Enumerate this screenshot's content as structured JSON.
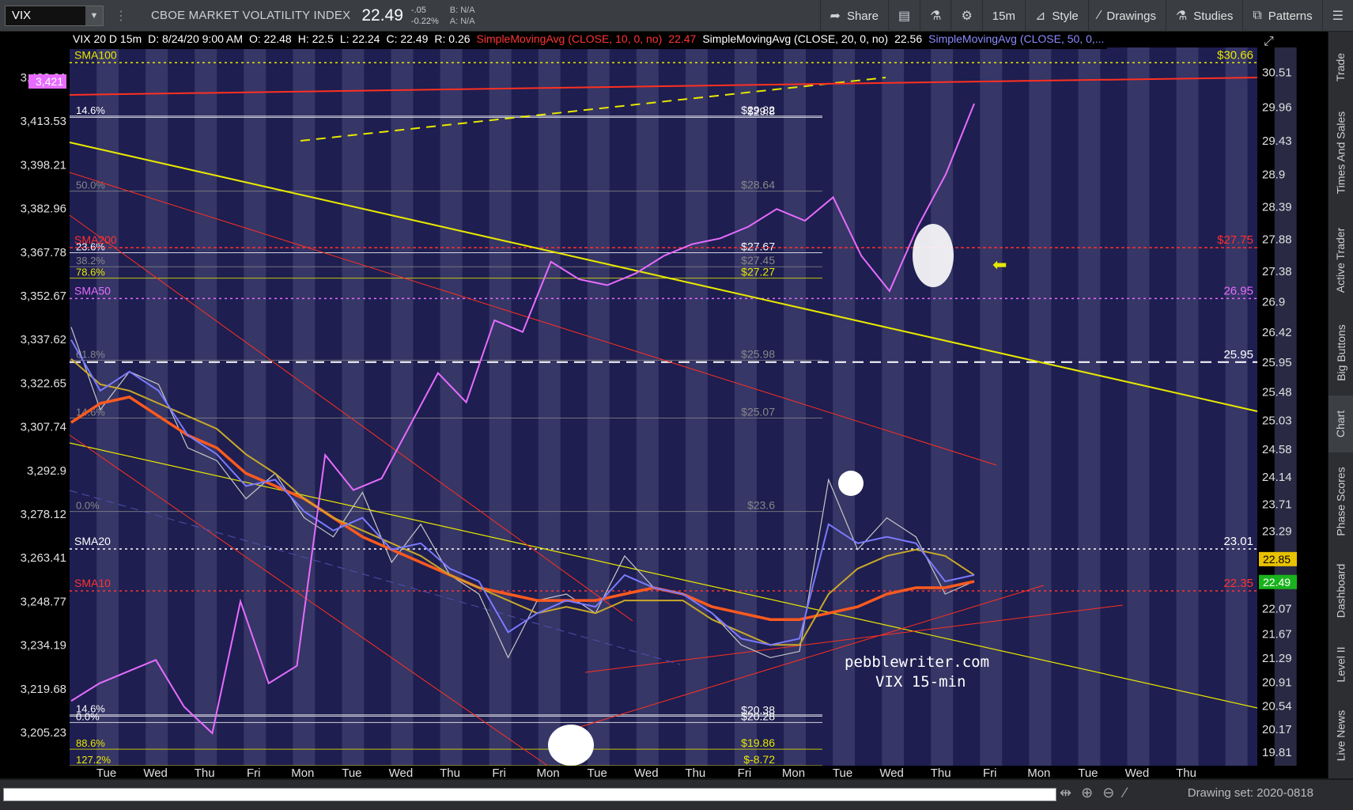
{
  "toolbar": {
    "symbol": "VIX",
    "name": "CBOE MARKET VOLATILITY INDEX",
    "price": "22.49",
    "change": "-.05",
    "change_pct": "-0.22%",
    "bid": "B: N/A",
    "ask": "A: N/A",
    "share": "Share",
    "timeframe": "15m",
    "style": "Style",
    "drawings": "Drawings",
    "studies": "Studies",
    "patterns": "Patterns"
  },
  "info": {
    "symbol": "VIX 20 D 15m",
    "date": "D: 8/24/20 9:00 AM",
    "open": "O: 22.48",
    "high": "H: 22.5",
    "low": "L: 22.24",
    "close": "C: 22.49",
    "range": "R: 0.26",
    "sma10": "SimpleMovingAvg (CLOSE, 10, 0, no)",
    "sma10_val": "22.47",
    "sma20": "SimpleMovingAvg (CLOSE, 20, 0, no)",
    "sma20_val": "22.56",
    "sma50": "SimpleMovingAvg (CLOSE, 50, 0,..."
  },
  "right_tabs": [
    "Trade",
    "Times And Sales",
    "Active Trader",
    "Big Buttons",
    "Chart",
    "Phase Scores",
    "Dashboard",
    "Level II",
    "Live News"
  ],
  "active_tab": "Chart",
  "bottom": {
    "drawing_set": "Drawing set: 2020-0818"
  },
  "watermark": {
    "line1": "pebblewriter.com",
    "line2": "VIX 15-min"
  },
  "chart_data": {
    "type": "line",
    "x_labels": [
      "Tue",
      "Wed",
      "Thu",
      "Fri",
      "Mon",
      "Tue",
      "Wed",
      "Thu",
      "Fri",
      "Mon",
      "Tue",
      "Wed",
      "Thu",
      "Fri",
      "Mon",
      "Tue",
      "Wed",
      "Thu",
      "Fri",
      "Mon",
      "Tue",
      "Wed",
      "Thu"
    ],
    "left_axis": [
      "3,428.91",
      "3,413.53",
      "3,398.21",
      "3,382.96",
      "3,367.78",
      "3,352.67",
      "3,337.62",
      "3,322.65",
      "3,307.74",
      "3,292.9",
      "3,278.12",
      "3,263.41",
      "3,248.77",
      "3,234.19",
      "3,219.68",
      "3,205.23"
    ],
    "right_axis": [
      "30.51",
      "29.96",
      "29.43",
      "28.9",
      "28.39",
      "27.88",
      "27.38",
      "26.9",
      "26.42",
      "25.95",
      "25.48",
      "25.03",
      "24.58",
      "24.14",
      "23.71",
      "23.29",
      "22.07",
      "21.67",
      "21.29",
      "20.91",
      "20.54",
      "20.17",
      "19.81"
    ],
    "ylim_right": [
      19.6,
      30.9
    ],
    "left_price_tag": "3,421",
    "tags": [
      {
        "text": "22.85",
        "value": 22.85,
        "bg": "#e8c200",
        "fg": "#000000"
      },
      {
        "text": "22.49",
        "value": 22.49,
        "bg": "#19b31c",
        "fg": "#ffffff"
      }
    ],
    "hlines": [
      {
        "label": "SMA20",
        "value_label": "23.01",
        "value": 23.01,
        "color": "#ffffff",
        "dash": "3,4"
      },
      {
        "label": "SMA10",
        "value_label": "22.35",
        "value": 22.35,
        "color": "#ff3333",
        "dash": "3,4"
      },
      {
        "label": "SMA50",
        "value_label": "26.95",
        "value": 26.95,
        "color": "#e66cff",
        "dash": "3,4"
      },
      {
        "label": "SMA200",
        "value_label": "$27.75",
        "value": 27.75,
        "color": "#ff3030",
        "dash": "4,3"
      },
      {
        "label": "SMA100",
        "value_label": "$30.66",
        "value": 30.66,
        "color": "#e8e800",
        "dash": "3,4"
      },
      {
        "label": "",
        "value_label": "25.95",
        "value": 25.95,
        "color": "#ffffff",
        "dash": "14,8"
      }
    ],
    "fib_levels": [
      {
        "label": "14.6%",
        "value_label": "$29.82",
        "value": 29.82,
        "color": "#ffffff"
      },
      {
        "label": "",
        "value_label": "$29.8",
        "value": 29.8,
        "color": "#ffffff"
      },
      {
        "label": "50.0%",
        "value_label": "$28.64",
        "value": 28.64,
        "color": "#888888"
      },
      {
        "label": "23.6%",
        "value_label": "$27.67",
        "value": 27.67,
        "color": "#ffffff"
      },
      {
        "label": "38.2%",
        "value_label": "$27.45",
        "value": 27.45,
        "color": "#888888"
      },
      {
        "label": "78.6%",
        "value_label": "$27.27",
        "value": 27.27,
        "color": "#e8e800"
      },
      {
        "label": "61.8%",
        "value_label": "$25.98",
        "value": 25.98,
        "color": "#888888"
      },
      {
        "label": "14.6%",
        "value_label": "$25.07",
        "value": 25.07,
        "color": "#888888"
      },
      {
        "label": "0.0%",
        "value_label": "$23.6",
        "value": 23.6,
        "color": "#888888"
      },
      {
        "label": "14.6%",
        "value_label": "",
        "value": 20.4,
        "color": "#ffffff"
      },
      {
        "label": "0.0%",
        "value_label": "$20.28",
        "value": 20.28,
        "color": "#ffffff"
      },
      {
        "label": "",
        "value_label": "$20.38",
        "value": 20.38,
        "color": "#ffffff"
      },
      {
        "label": "88.6%",
        "value_label": "$19.86",
        "value": 19.86,
        "color": "#e8e800"
      },
      {
        "label": "127.2%",
        "value_label": "$-8.72",
        "value": 19.6,
        "color": "#e8e800"
      }
    ],
    "series": [
      {
        "name": "VIX",
        "color": "#c8c8c8",
        "values": [
          26.5,
          25.2,
          25.8,
          25.6,
          24.6,
          24.4,
          23.8,
          24.2,
          23.5,
          23.2,
          23.9,
          22.8,
          23.4,
          22.6,
          22.3,
          21.3,
          22.2,
          22.3,
          22.0,
          22.9,
          22.4,
          22.3,
          22.0,
          21.5,
          21.3,
          21.4,
          24.1,
          23.0,
          23.5,
          23.2,
          22.3,
          22.5
        ]
      },
      {
        "name": "SMA10",
        "color": "#ff5a1e",
        "values": [
          25.0,
          25.3,
          25.4,
          25.1,
          24.8,
          24.6,
          24.2,
          24.0,
          23.8,
          23.5,
          23.2,
          23.0,
          22.8,
          22.6,
          22.4,
          22.3,
          22.2,
          22.2,
          22.2,
          22.3,
          22.4,
          22.3,
          22.1,
          22.0,
          21.9,
          21.9,
          22.0,
          22.1,
          22.3,
          22.4,
          22.4,
          22.5
        ]
      },
      {
        "name": "SMA20",
        "color": "#c8a82a",
        "values": [
          26.0,
          25.6,
          25.5,
          25.3,
          25.1,
          24.9,
          24.5,
          24.2,
          23.8,
          23.5,
          23.3,
          23.1,
          22.9,
          22.6,
          22.4,
          22.2,
          22.0,
          22.1,
          22.0,
          22.2,
          22.2,
          22.2,
          21.9,
          21.7,
          21.5,
          21.5,
          22.3,
          22.7,
          22.9,
          23.0,
          22.9,
          22.6
        ]
      },
      {
        "name": "SMA50",
        "color": "#7a7aff",
        "values": [
          26.3,
          25.5,
          25.8,
          25.5,
          24.8,
          24.5,
          24.0,
          24.1,
          23.6,
          23.3,
          23.5,
          23.0,
          23.1,
          22.7,
          22.5,
          21.7,
          22.0,
          22.2,
          22.1,
          22.6,
          22.4,
          22.3,
          22.0,
          21.6,
          21.5,
          21.6,
          23.4,
          23.1,
          23.2,
          23.1,
          22.5,
          22.6
        ]
      },
      {
        "name": "SPX",
        "color": "#e66cff",
        "values": [
          3216,
          3222,
          3226,
          3230,
          3214,
          3205,
          3250,
          3222,
          3228,
          3300,
          3288,
          3292,
          3310,
          3328,
          3318,
          3346,
          3342,
          3366,
          3360,
          3358,
          3362,
          3368,
          3372,
          3374,
          3378,
          3384,
          3380,
          3388,
          3368,
          3356,
          3378,
          3396,
          3420
        ]
      }
    ]
  }
}
